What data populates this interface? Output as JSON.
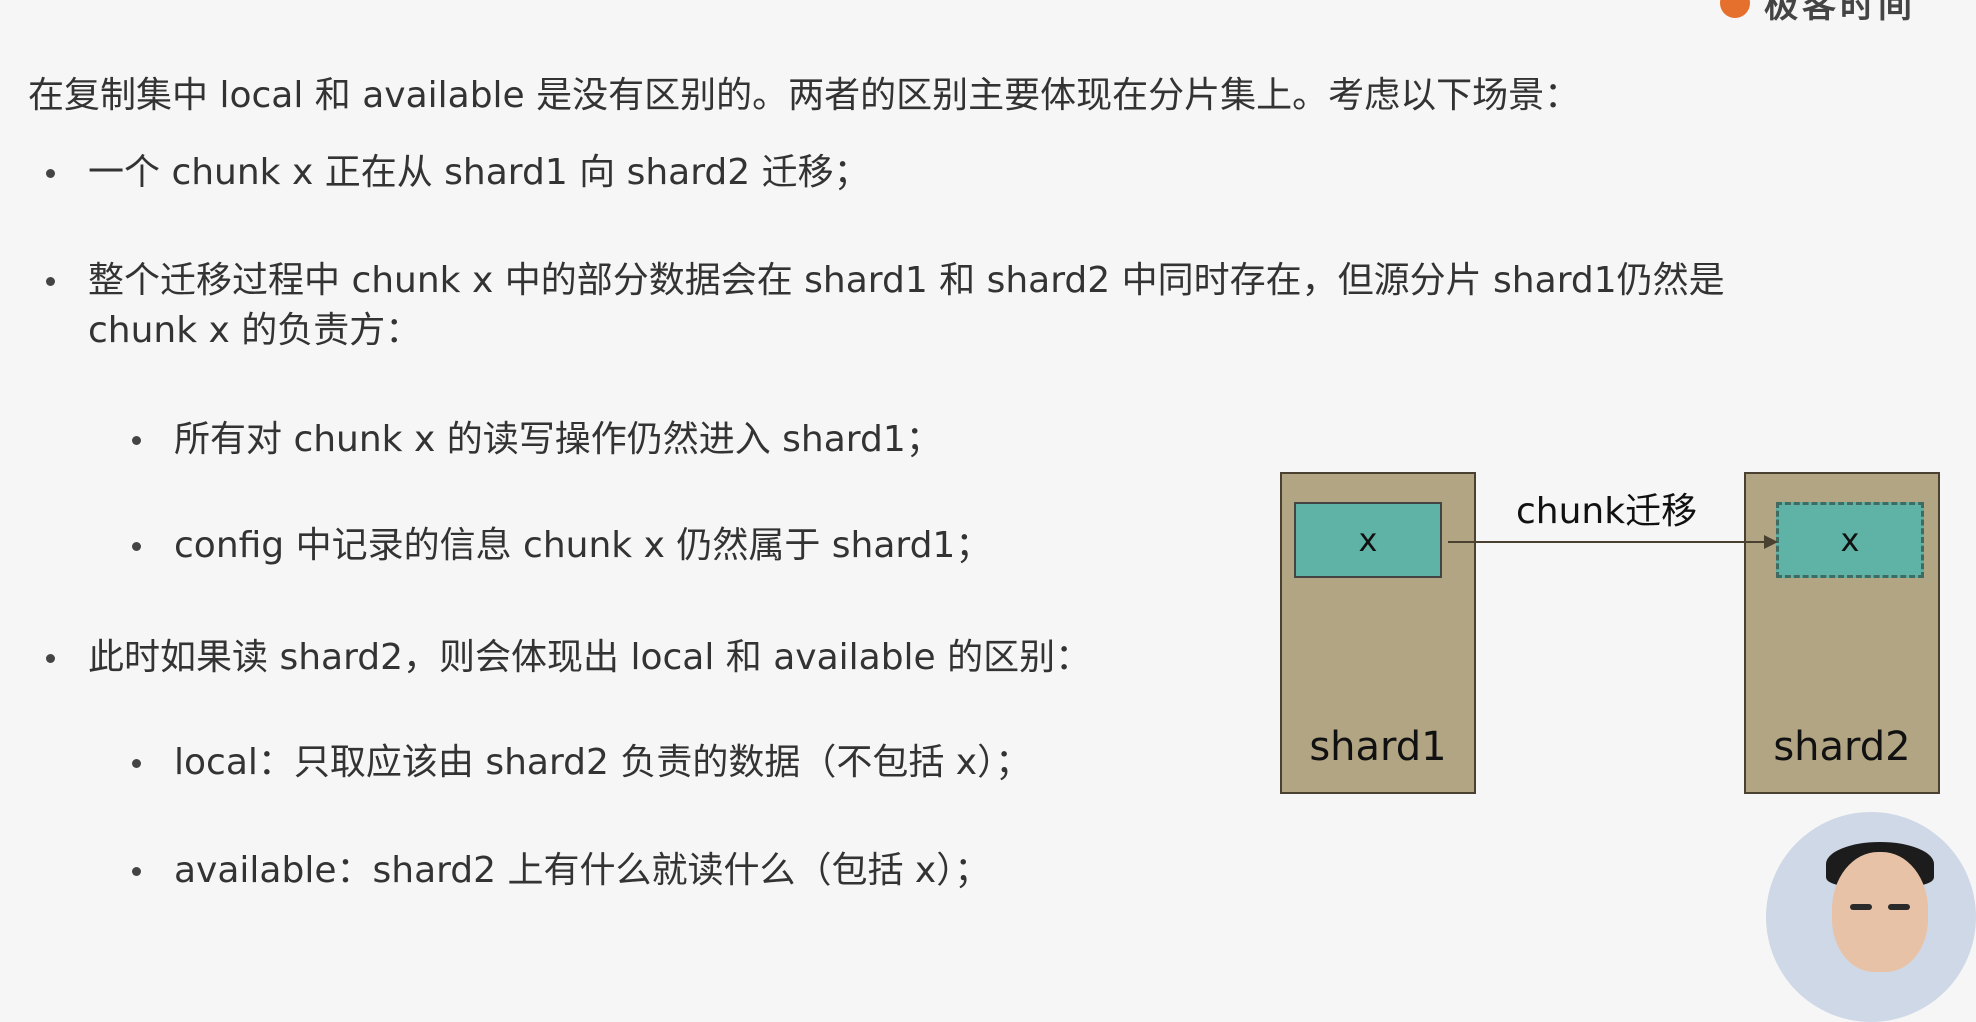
{
  "logo": {
    "text": "极客时间"
  },
  "intro": "在复制集中 local 和 available 是没有区别的。两者的区别主要体现在分片集上。考虑以下场景：",
  "bullets": [
    {
      "text": "一个 chunk x 正在从 shard1 向 shard2 迁移；"
    },
    {
      "line1": "整个迁移过程中 chunk x 中的部分数据会在 shard1 和 shard2 中同时存在，但源分片 shard1仍然是",
      "line2": "chunk x 的负责方："
    },
    {
      "text": "所有对 chunk x 的读写操作仍然进入 shard1；"
    },
    {
      "text": "config 中记录的信息 chunk x 仍然属于 shard1；"
    },
    {
      "text": "此时如果读 shard2，则会体现出 local 和 available 的区别："
    },
    {
      "text": "local：只取应该由 shard2 负责的数据（不包括 x）；"
    },
    {
      "text": "available：shard2 上有什么就读什么（包括 x）；"
    }
  ],
  "diagram": {
    "source": {
      "label": "shard1",
      "chunk": "x"
    },
    "target": {
      "label": "shard2",
      "chunk": "x"
    },
    "move_label": "chunk迁移",
    "colors": {
      "shard_fill": "#b2a583",
      "chunk_fill": "#5fb3a6",
      "border": "#4a4130"
    }
  },
  "icons": {
    "logo": "geektime-logo-icon",
    "presenter": "presenter-video"
  }
}
